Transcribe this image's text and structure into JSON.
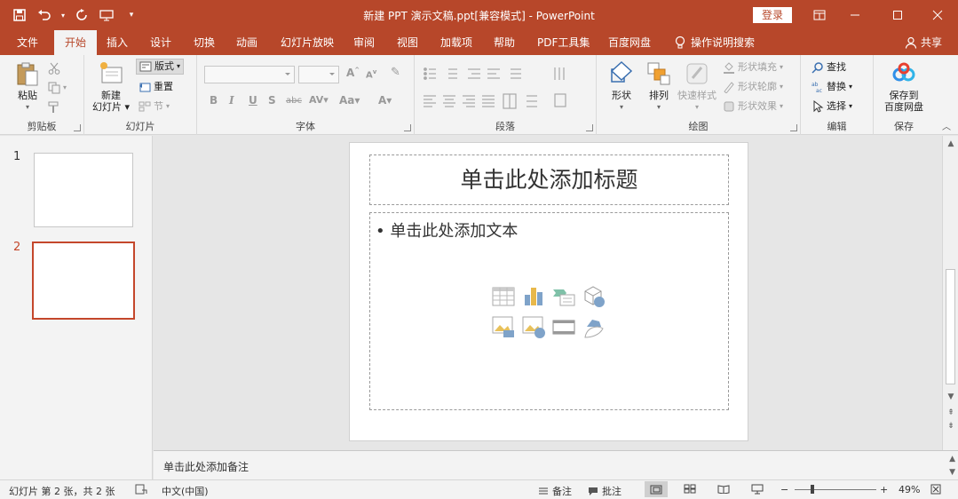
{
  "window": {
    "title": "新建 PPT 演示文稿.ppt[兼容模式] - PowerPoint",
    "login_label": "登录"
  },
  "tabs": [
    {
      "label": "文件",
      "active": false
    },
    {
      "label": "开始",
      "active": true
    },
    {
      "label": "插入",
      "active": false
    },
    {
      "label": "设计",
      "active": false
    },
    {
      "label": "切换",
      "active": false
    },
    {
      "label": "动画",
      "active": false
    },
    {
      "label": "幻灯片放映",
      "active": false
    },
    {
      "label": "审阅",
      "active": false
    },
    {
      "label": "视图",
      "active": false
    },
    {
      "label": "加载项",
      "active": false
    },
    {
      "label": "帮助",
      "active": false
    },
    {
      "label": "PDF工具集",
      "active": false
    },
    {
      "label": "百度网盘",
      "active": false
    },
    {
      "label": "操作说明搜索",
      "active": false
    }
  ],
  "share_label": "共享",
  "ribbon": {
    "clipboard": {
      "group": "剪贴板",
      "paste": "粘贴"
    },
    "slides": {
      "group": "幻灯片",
      "new_slide_line1": "新建",
      "new_slide_line2": "幻灯片",
      "layout": "版式",
      "reset": "重置",
      "section": "节"
    },
    "font": {
      "group": "字体"
    },
    "paragraph": {
      "group": "段落"
    },
    "drawing": {
      "group": "绘图",
      "shapes": "形状",
      "arrange": "排列",
      "quick_styles": "快速样式",
      "fill": "形状填充",
      "outline": "形状轮廓",
      "effects": "形状效果"
    },
    "editing": {
      "group": "编辑",
      "find": "查找",
      "replace": "替换",
      "select": "选择"
    },
    "save": {
      "group": "保存",
      "line1": "保存到",
      "line2": "百度网盘"
    }
  },
  "slides": [
    {
      "number": "1",
      "selected": false
    },
    {
      "number": "2",
      "selected": true
    }
  ],
  "slide": {
    "title_placeholder": "单击此处添加标题",
    "body_placeholder": "单击此处添加文本"
  },
  "notes_placeholder": "单击此处添加备注",
  "status": {
    "slide_info": "幻灯片 第 2 张，共 2 张",
    "language": "中文(中国)",
    "notes": "备注",
    "comments": "批注",
    "zoom": "49%",
    "zoom_level": 0.49
  }
}
